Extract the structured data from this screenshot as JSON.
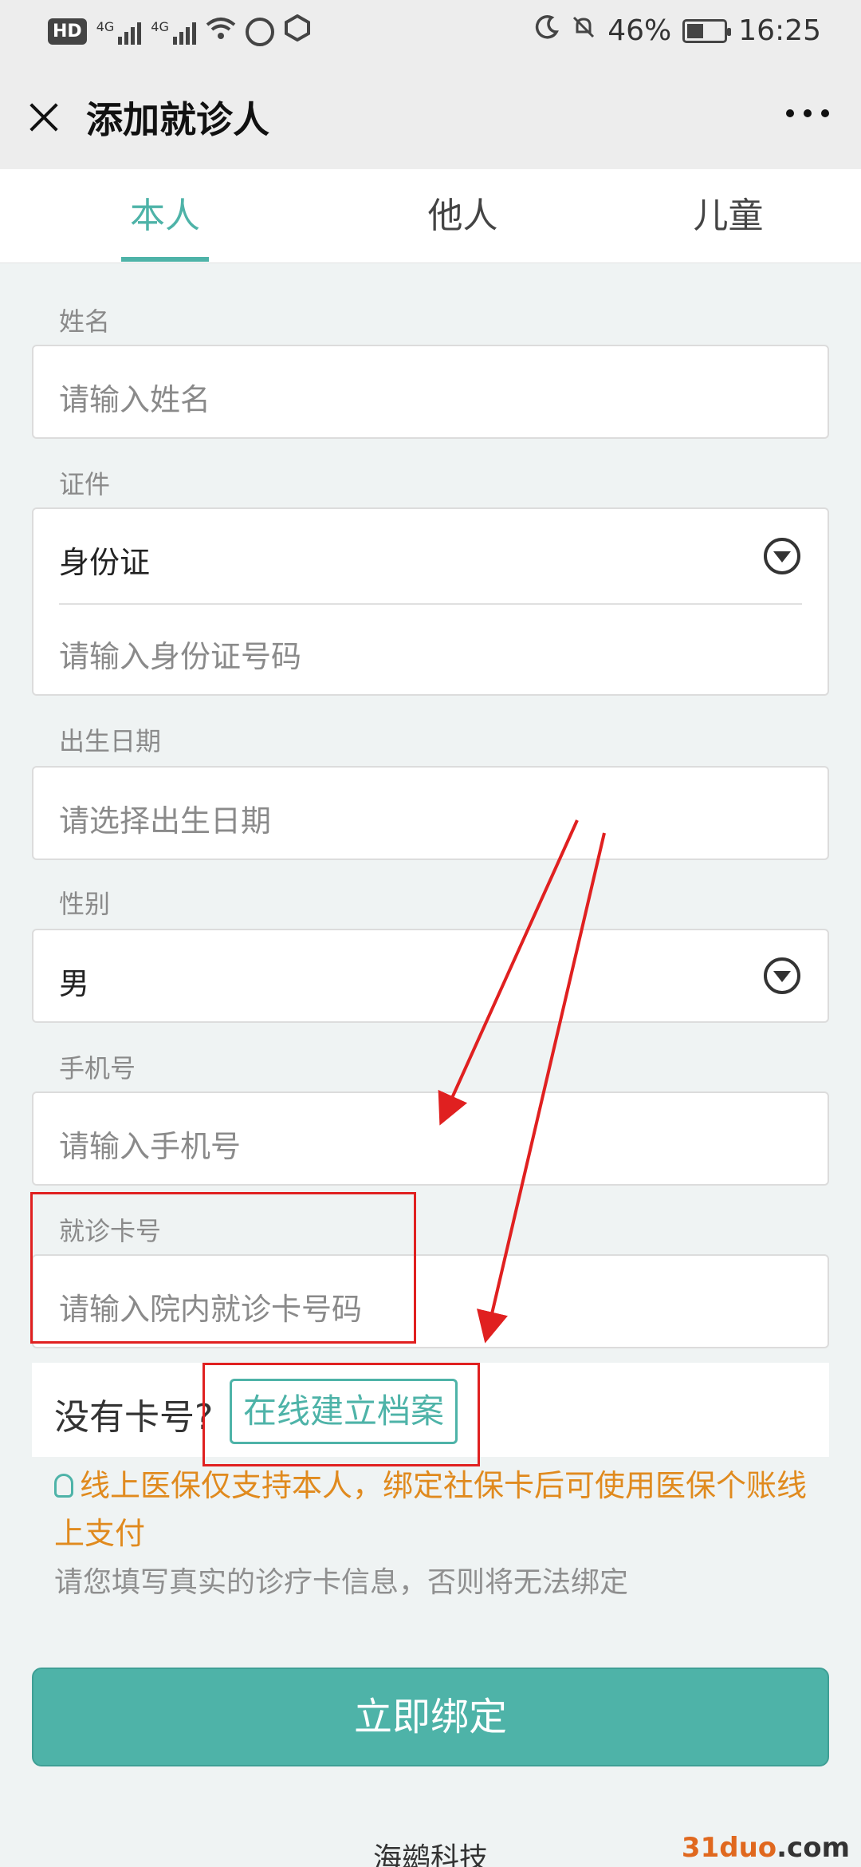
{
  "status_bar": {
    "hd": "HD",
    "network1": "4G",
    "network2": "4G",
    "battery_text": "46%",
    "battery_level": 0.46,
    "time": "16:25"
  },
  "title_bar": {
    "title": "添加就诊人"
  },
  "tabs": [
    {
      "label": "本人",
      "active": true
    },
    {
      "label": "他人",
      "active": false
    },
    {
      "label": "儿童",
      "active": false
    }
  ],
  "form": {
    "name": {
      "label": "姓名",
      "placeholder": "请输入姓名"
    },
    "id": {
      "label": "证件",
      "type_value": "身份证",
      "placeholder": "请输入身份证号码"
    },
    "birth": {
      "label": "出生日期",
      "placeholder": "请选择出生日期"
    },
    "gender": {
      "label": "性别",
      "value": "男"
    },
    "phone": {
      "label": "手机号",
      "placeholder": "请输入手机号"
    },
    "card": {
      "label": "就诊卡号",
      "placeholder": "请输入院内就诊卡号码"
    }
  },
  "no_card": {
    "text": "没有卡号?",
    "button": "在线建立档案"
  },
  "notice": "线上医保仅支持本人，绑定社保卡后可使用医保个账线上支付",
  "hint": "请您填写真实的诊疗卡信息，否则将无法绑定",
  "submit_label": "立即绑定",
  "footer": "海鹚科技",
  "watermark": {
    "brand": "31duo",
    "suffix": ".com"
  },
  "colors": {
    "accent": "#4eb3a8",
    "notice": "#e08a1e",
    "annotation": "#e02020"
  }
}
